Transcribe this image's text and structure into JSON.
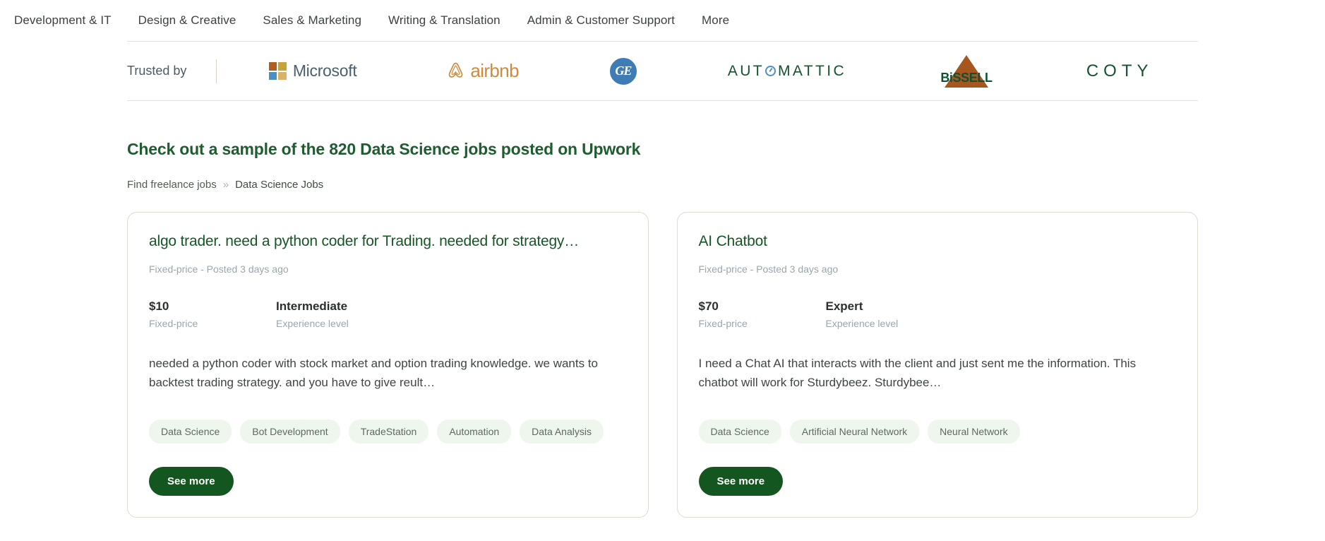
{
  "topnav": {
    "items": [
      {
        "label": "Development & IT"
      },
      {
        "label": "Design & Creative"
      },
      {
        "label": "Sales & Marketing"
      },
      {
        "label": "Writing & Translation"
      },
      {
        "label": "Admin & Customer Support"
      },
      {
        "label": "More"
      }
    ]
  },
  "trusted": {
    "label": "Trusted by",
    "logos": [
      {
        "name": "microsoft-logo",
        "text": "Microsoft"
      },
      {
        "name": "airbnb-logo",
        "text": "airbnb"
      },
      {
        "name": "ge-logo",
        "text": "GE"
      },
      {
        "name": "automattic-logo",
        "text_before": "AUT",
        "text_after": "MATTIC"
      },
      {
        "name": "bissell-logo",
        "text": "BiSSELL"
      },
      {
        "name": "coty-logo",
        "text": "COTY"
      }
    ]
  },
  "sample": {
    "heading": "Check out a sample of the 820 Data Science jobs posted on Upwork",
    "breadcrumb": {
      "root": "Find freelance jobs",
      "separator": "»",
      "current": "Data Science Jobs"
    }
  },
  "cards": [
    {
      "title": "algo trader. need a python coder for Trading. needed for strategy…",
      "meta": "Fixed-price - Posted 3 days ago",
      "price_value": "$10",
      "price_label": "Fixed-price",
      "level_value": "Intermediate",
      "level_label": "Experience level",
      "description": "needed a python coder with stock market and option trading knowledge. we wants to backtest trading strategy. and you have to give reult…",
      "tags": [
        "Data Science",
        "Bot Development",
        "TradeStation",
        "Automation",
        "Data Analysis"
      ],
      "button": "See more"
    },
    {
      "title": "AI Chatbot",
      "meta": "Fixed-price - Posted 3 days ago",
      "price_value": "$70",
      "price_label": "Fixed-price",
      "level_value": "Expert",
      "level_label": "Experience level",
      "description": "I need a Chat AI that interacts with the client and just sent me the information. This chatbot will work for Sturdybeez. Sturdybee…",
      "tags": [
        "Data Science",
        "Artificial Neural Network",
        "Neural Network"
      ],
      "button": "See more"
    }
  ],
  "colors": {
    "brand_green": "#14561f",
    "heading_green": "#1f5c2f",
    "tag_bg": "#eef6ee",
    "card_border": "#dedbd0",
    "muted_text": "#9aa6ad"
  }
}
